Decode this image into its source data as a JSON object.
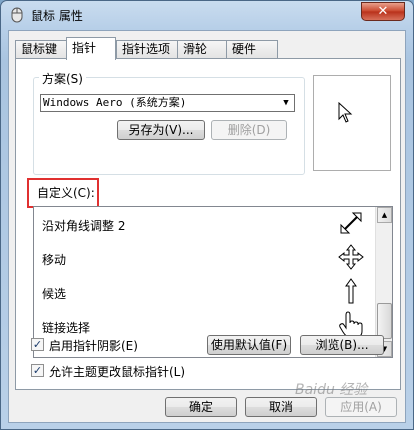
{
  "window": {
    "title": "鼠标 属性",
    "close_label": "✕"
  },
  "tabs": [
    {
      "label": "鼠标键",
      "active": false
    },
    {
      "label": "指针",
      "active": true
    },
    {
      "label": "指针选项",
      "active": false
    },
    {
      "label": "滑轮",
      "active": false
    },
    {
      "label": "硬件",
      "active": false
    }
  ],
  "scheme": {
    "label": "方案(S)",
    "selected": "Windows Aero (系统方案)",
    "save_as_label": "另存为(V)...",
    "delete_label": "删除(D)"
  },
  "customize": {
    "label": "自定义(C):",
    "rows": [
      {
        "label": "沿对角线调整 2",
        "icon": "resize-diagonal-icon"
      },
      {
        "label": "移动",
        "icon": "move-icon"
      },
      {
        "label": "候选",
        "icon": "up-arrow-icon"
      },
      {
        "label": "链接选择",
        "icon": "hand-icon"
      }
    ]
  },
  "options": {
    "shadow_label": "启用指针阴影(E)",
    "shadow_checked": true,
    "theme_label": "允许主题更改鼠标指针(L)",
    "theme_checked": true,
    "default_label": "使用默认值(F)",
    "browse_label": "浏览(B)..."
  },
  "footer": {
    "ok_label": "确定",
    "cancel_label": "取消",
    "apply_label": "应用(A)"
  },
  "watermark": "Baidu 经验"
}
